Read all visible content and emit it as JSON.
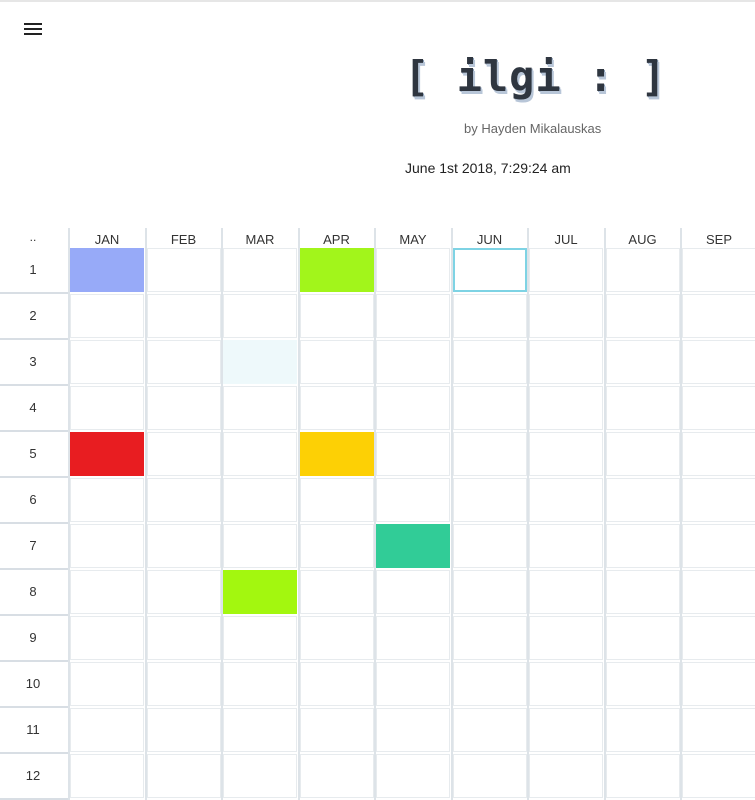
{
  "header": {
    "logo": "[ ilgi : ]",
    "author": "by Hayden Mikalauskas",
    "datetime": "June 1st 2018, 7:29:24 am",
    "menu_icon": "hamburger-menu-icon"
  },
  "calendar": {
    "corner_label": "..",
    "months": [
      "JAN",
      "FEB",
      "MAR",
      "APR",
      "MAY",
      "JUN",
      "JUL",
      "AUG",
      "SEP"
    ],
    "days": [
      "1",
      "2",
      "3",
      "4",
      "5",
      "6",
      "7",
      "8",
      "9",
      "10",
      "11",
      "12"
    ],
    "selected": {
      "month": "JUN",
      "day": "1"
    },
    "colored_cells": [
      {
        "month": "JAN",
        "day": "1",
        "color": "#97aaf8"
      },
      {
        "month": "APR",
        "day": "1",
        "color": "#a2f51b"
      },
      {
        "month": "MAR",
        "day": "3",
        "color": "#eef9fb"
      },
      {
        "month": "JAN",
        "day": "5",
        "color": "#e81d21"
      },
      {
        "month": "APR",
        "day": "5",
        "color": "#fdd005"
      },
      {
        "month": "MAY",
        "day": "7",
        "color": "#31cc97"
      },
      {
        "month": "MAR",
        "day": "8",
        "color": "#a3f70f"
      }
    ]
  }
}
